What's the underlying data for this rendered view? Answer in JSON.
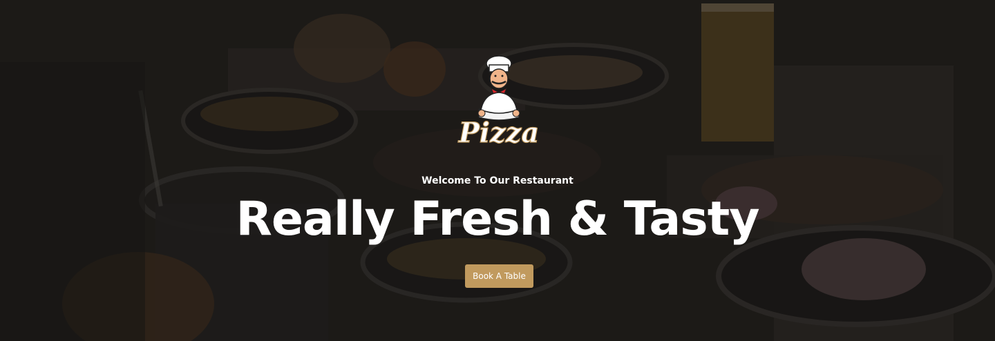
{
  "hero": {
    "logo_text": "Pizza",
    "subtitle": "Welcome To Our Restaurant",
    "headline": "Really Fresh & Tasty",
    "cta_label": "Book A Table"
  },
  "colors": {
    "accent": "#c19a5e",
    "text": "#ffffff"
  },
  "icons": {
    "logo": "chef-mascot-icon"
  }
}
